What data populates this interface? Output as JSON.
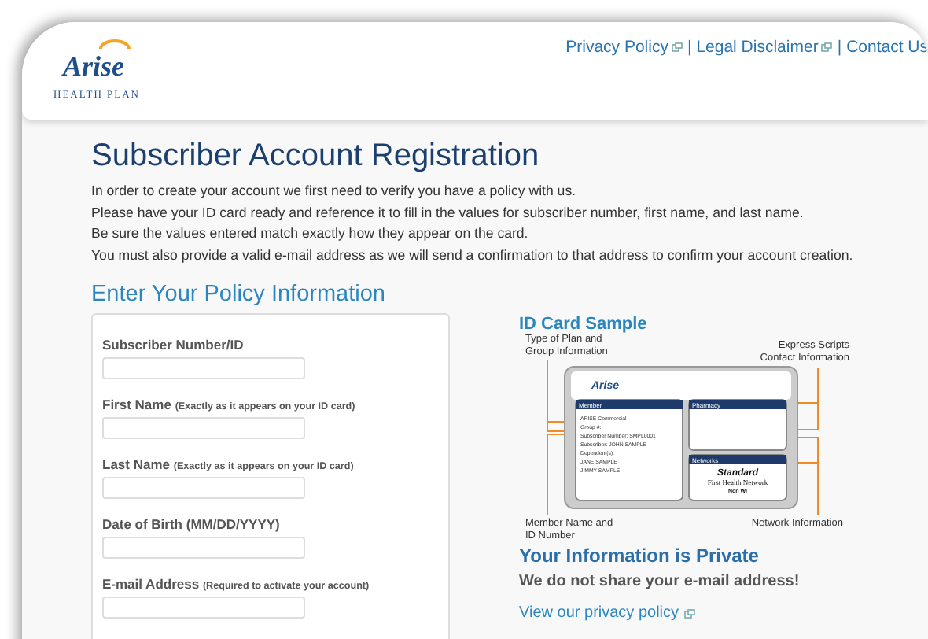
{
  "header": {
    "logo": {
      "name": "Arise",
      "tagline": "HEALTH PLAN"
    },
    "separators": [
      "|",
      "|"
    ],
    "links": [
      {
        "label": "Privacy Policy",
        "external": true
      },
      {
        "label": "Legal Disclaimer",
        "external": true
      },
      {
        "label": "Contact Us",
        "external": false
      }
    ]
  },
  "title": "Subscriber Account Registration",
  "intro": [
    "In order to create your account we first need to verify you have a policy with us.",
    "Please have your ID card ready and reference it to fill in the values for subscriber number, first name, and last name.",
    "Be sure the values entered match exactly how they appear on the card.",
    "You must also provide a valid e-mail address as we will send a confirmation to that address to confirm your account creation."
  ],
  "form": {
    "heading": "Enter Your Policy Information",
    "fields": [
      {
        "label": "Subscriber Number/ID"
      },
      {
        "label": "First Name",
        "hint": "(Exactly as it appears on your ID card)"
      },
      {
        "label": "Last Name",
        "hint": "(Exactly as it appears on your ID card)"
      },
      {
        "label": "Date of Birth (MM/DD/YYYY)"
      },
      {
        "label": "E-mail Address",
        "hint": "(Required to activate your account)"
      }
    ]
  },
  "id_card": {
    "heading": "ID Card Sample",
    "callouts": [
      {
        "text": "Type of Plan and Group Information"
      },
      {
        "text": "Express Scripts Contact Information"
      },
      {
        "text": "Member Name and ID Number"
      },
      {
        "text": "Network Information"
      }
    ],
    "card": {
      "logo": "Arise",
      "member_title": "Member",
      "member_lines": [
        "ARISE Commercial",
        "Group #:",
        "Subscriber Number: SMPL0001",
        "Subscriber: JOHN SAMPLE",
        "Dependent(s):",
        "JANE SAMPLE",
        "JIMMY SAMPLE"
      ],
      "pharmacy_title": "Pharmacy",
      "networks_title": "Networks",
      "network_name": "Standard",
      "network_brand": "First Health Network",
      "network_note": "Non WI"
    }
  },
  "privacy": {
    "heading": "Your Information is Private",
    "text": "We do not share your e-mail address!",
    "link": {
      "label": "View our privacy policy",
      "external": true
    }
  }
}
